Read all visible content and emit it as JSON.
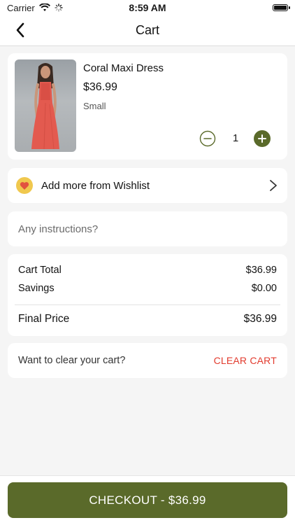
{
  "status_bar": {
    "carrier": "Carrier",
    "time": "8:59 AM"
  },
  "nav": {
    "title": "Cart"
  },
  "item": {
    "name": "Coral Maxi Dress",
    "price": "$36.99",
    "size": "Small",
    "quantity": "1",
    "image_icon": "dress-photo"
  },
  "wishlist": {
    "label": "Add more from Wishlist",
    "icon": "heart-icon"
  },
  "instructions": {
    "placeholder": "Any instructions?",
    "value": ""
  },
  "totals": {
    "cart_total_label": "Cart Total",
    "cart_total_value": "$36.99",
    "savings_label": "Savings",
    "savings_value": "$0.00",
    "final_label": "Final Price",
    "final_value": "$36.99"
  },
  "clear": {
    "prompt": "Want to clear your cart?",
    "button": "CLEAR CART"
  },
  "checkout": {
    "label": "CHECKOUT - $36.99"
  },
  "colors": {
    "accent": "#5a6a2a",
    "danger": "#e23b2e",
    "wish": "#f0c84e"
  }
}
